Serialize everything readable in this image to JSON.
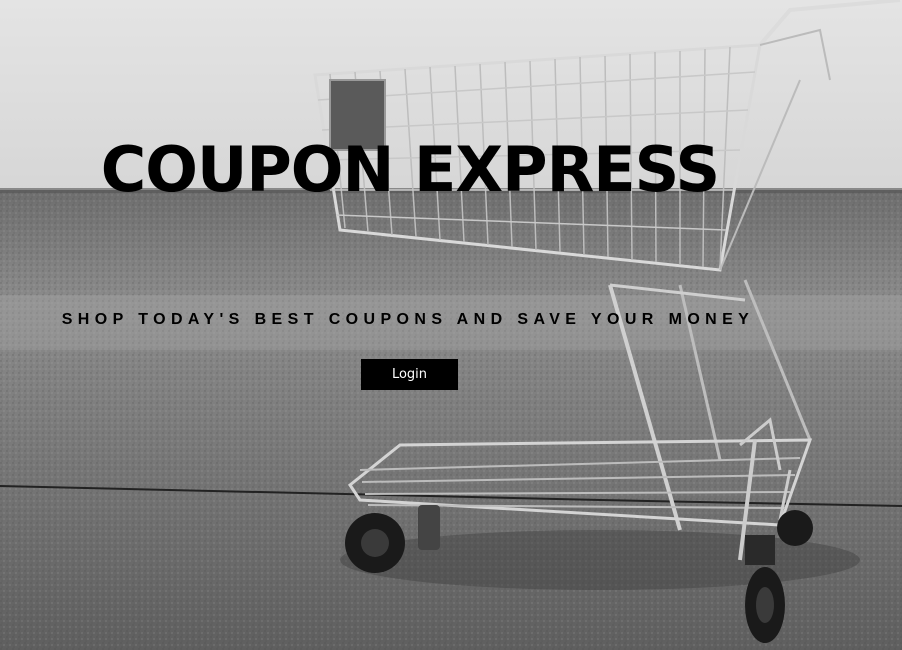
{
  "hero": {
    "title": "COUPON EXPRESS",
    "tagline": "SHOP TODAY'S BEST COUPONS AND SAVE YOUR MONEY",
    "login_label": "Login",
    "background_image": "shopping-cart-photo"
  }
}
